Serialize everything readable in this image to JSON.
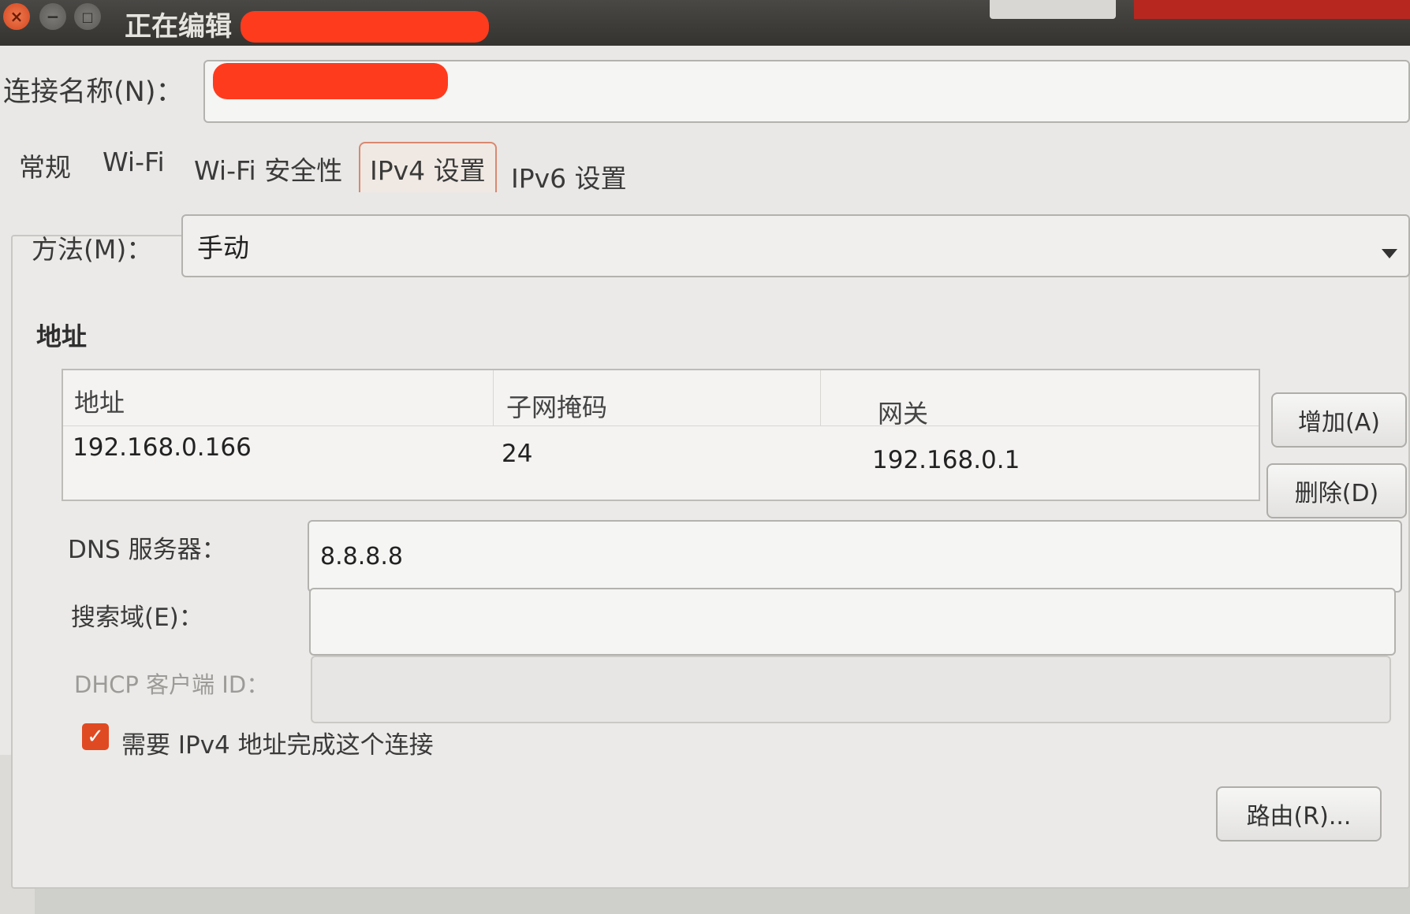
{
  "window": {
    "title": "正在编辑",
    "close_glyph": "×",
    "minimize_glyph": "−",
    "maximize_glyph": "□"
  },
  "connection_name": {
    "label": "连接名称(N)："
  },
  "tabs": [
    {
      "label": "常规",
      "active": false
    },
    {
      "label": "Wi-Fi",
      "active": false
    },
    {
      "label": "Wi-Fi 安全性",
      "active": false
    },
    {
      "label": "IPv4 设置",
      "active": true
    },
    {
      "label": "IPv6 设置",
      "active": false
    }
  ],
  "method": {
    "label": "方法(M)：",
    "value": "手动"
  },
  "addresses": {
    "section_title": "地址",
    "columns": [
      "地址",
      "子网掩码",
      "网关"
    ],
    "rows": [
      [
        "192.168.0.166",
        "24",
        "192.168.0.1"
      ]
    ],
    "add_button": "增加(A)",
    "delete_button": "删除(D)"
  },
  "dns": {
    "label": "DNS 服务器：",
    "value": "8.8.8.8"
  },
  "search_domains": {
    "label": "搜索域(E)：",
    "value": ""
  },
  "dhcp_client_id": {
    "label": "DHCP 客户端 ID：",
    "value": ""
  },
  "require_ipv4": {
    "label": "需要 IPv4 地址完成这个连接",
    "checked": true,
    "check_glyph": "✓"
  },
  "routes_button": "路由(R)...",
  "colors": {
    "accent": "#e04a22",
    "redaction": "#ff3b1e"
  }
}
